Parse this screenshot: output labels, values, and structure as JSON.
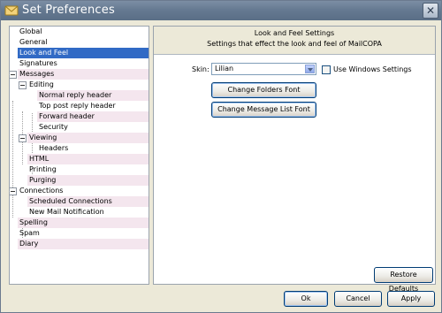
{
  "window": {
    "title": "Set Preferences"
  },
  "tree": {
    "items": [
      {
        "label": "Global",
        "level": 0,
        "selected": false
      },
      {
        "label": "General",
        "level": 0,
        "selected": false
      },
      {
        "label": "Look and Feel",
        "level": 0,
        "selected": true
      },
      {
        "label": "Signatures",
        "level": 0,
        "selected": false
      },
      {
        "label": "Messages",
        "level": 0,
        "expanded": true
      },
      {
        "label": "Editing",
        "level": 1,
        "expanded": true
      },
      {
        "label": "Normal reply header",
        "level": 2
      },
      {
        "label": "Top post reply header",
        "level": 2
      },
      {
        "label": "Forward header",
        "level": 2
      },
      {
        "label": "Security",
        "level": 2
      },
      {
        "label": "Viewing",
        "level": 1,
        "expanded": true
      },
      {
        "label": "Headers",
        "level": 2
      },
      {
        "label": "HTML",
        "level": 1
      },
      {
        "label": "Printing",
        "level": 1
      },
      {
        "label": "Purging",
        "level": 1
      },
      {
        "label": "Connections",
        "level": 0,
        "expanded": true
      },
      {
        "label": "Scheduled Connections",
        "level": 1
      },
      {
        "label": "New Mail Notification",
        "level": 1
      },
      {
        "label": "Spelling",
        "level": 0
      },
      {
        "label": "Spam",
        "level": 0
      },
      {
        "label": "Diary",
        "level": 0
      }
    ]
  },
  "content": {
    "title": "Look and Feel Settings",
    "subtitle": "Settings that effect the look and feel of MailCOPA",
    "skin_label": "Skin:",
    "skin_value": "Lilian",
    "use_windows_settings_label": "Use Windows Settings",
    "use_windows_settings_checked": false,
    "change_folders_font": "Change Folders Font",
    "change_message_list_font": "Change Message List Font",
    "restore_defaults": "Restore Defaults"
  },
  "footer": {
    "ok": "Ok",
    "cancel": "Cancel",
    "apply": "Apply"
  },
  "colors": {
    "selection": "#316ac5",
    "titlebar": "#667a92",
    "dialog_bg": "#ece9d8"
  }
}
